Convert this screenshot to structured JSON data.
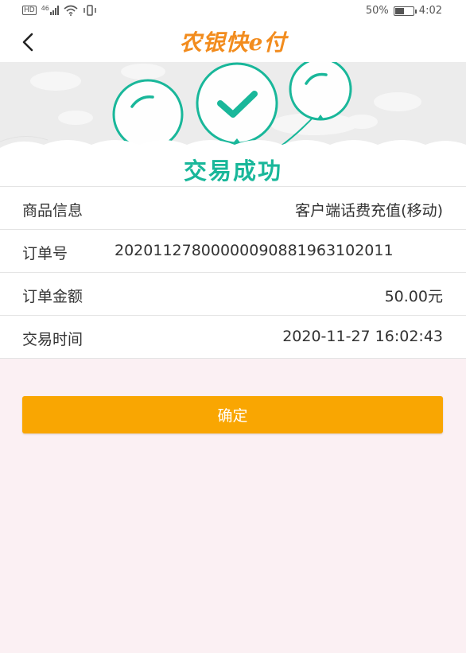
{
  "status_bar": {
    "hd": "HD",
    "network": "46",
    "battery_percent": "50%",
    "time": "4:02",
    "battery_level": 0.5,
    "icons": [
      "hd-icon",
      "signal-icon",
      "wifi-icon",
      "vibrate-icon",
      "battery-icon"
    ]
  },
  "nav": {
    "back_icon": "chevron-left-icon",
    "brand": "农银快e付"
  },
  "hero": {
    "title": "交易成功",
    "accent_color": "#19b79a"
  },
  "details": [
    {
      "label": "商品信息",
      "value": "客户端话费充值(移动)"
    },
    {
      "label": "订单号",
      "value": "20201127800000090881963102011"
    },
    {
      "label": "订单金额",
      "value": "50.00元"
    },
    {
      "label": "交易时间",
      "value": "2020-11-27 16:02:43"
    }
  ],
  "confirm_label": "确定",
  "colors": {
    "brand_orange": "#f28c1e",
    "button": "#f9a602",
    "page_bg": "#fbf0f3"
  }
}
